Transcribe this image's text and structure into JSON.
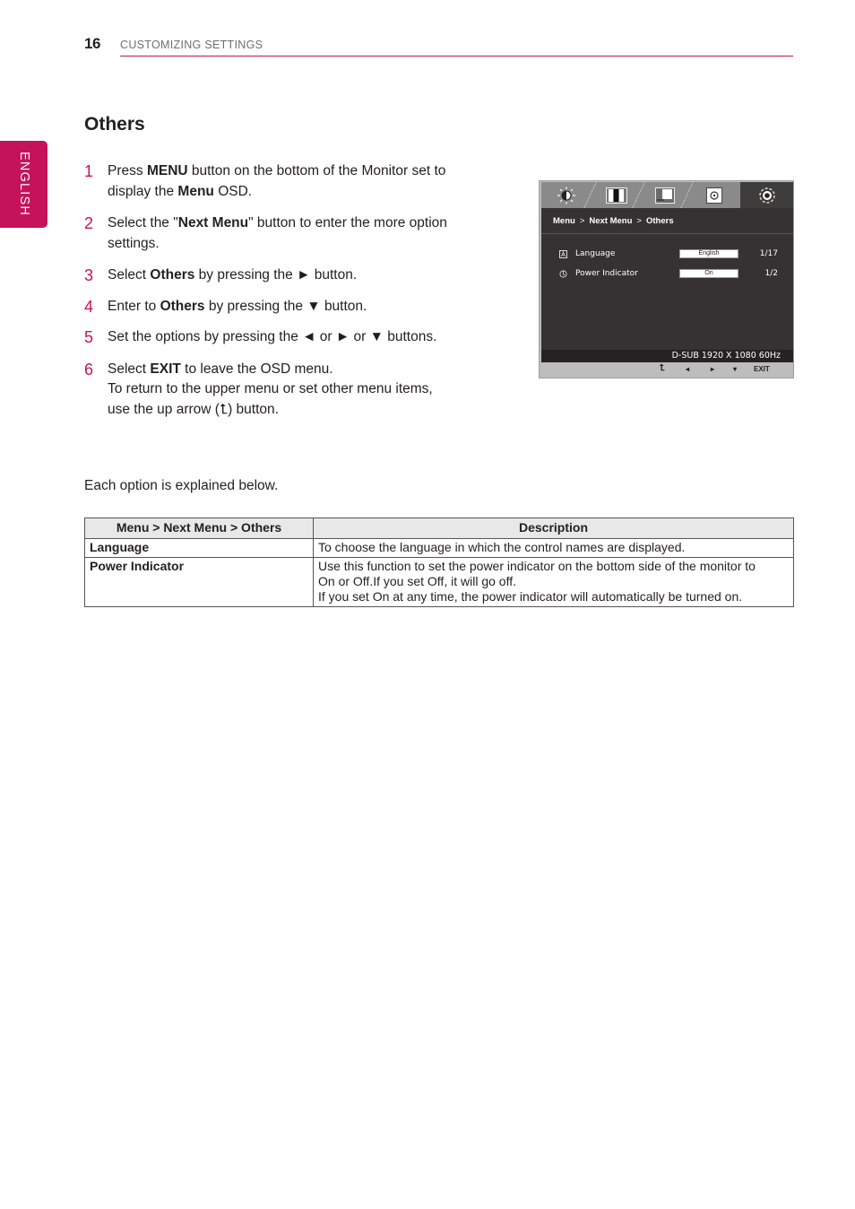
{
  "header": {
    "page_number": "16",
    "section": "CUSTOMIZING SETTINGS"
  },
  "language_tab": "ENGLISH",
  "title": "Others",
  "steps": [
    {
      "num": "1",
      "parts": [
        [
          "Press ",
          false
        ],
        [
          "MENU",
          true
        ],
        [
          " button on the bottom of the Monitor set to display the ",
          false
        ],
        [
          "Menu",
          true
        ],
        [
          " OSD.",
          false
        ]
      ]
    },
    {
      "num": "2",
      "parts": [
        [
          "Select the \"",
          false
        ],
        [
          "Next Menu",
          true
        ],
        [
          "\" button to enter the more option settings.",
          false
        ]
      ]
    },
    {
      "num": "3",
      "parts": [
        [
          "Select ",
          false
        ],
        [
          "Others",
          true
        ],
        [
          " by pressing the ► button.",
          false
        ]
      ]
    },
    {
      "num": "4",
      "parts": [
        [
          "Enter to ",
          false
        ],
        [
          "Others",
          true
        ],
        [
          " by pressing the ▼ button.",
          false
        ]
      ]
    },
    {
      "num": "5",
      "parts": [
        [
          "Set the options by pressing the ◄ or ► or ▼ buttons.",
          false
        ]
      ]
    },
    {
      "num": "6",
      "parts": [
        [
          "Select ",
          false
        ],
        [
          "EXIT",
          true
        ],
        [
          " to leave the OSD menu.",
          false
        ]
      ],
      "extra": [
        "To return to the upper menu or set other menu items,",
        "use the up arrow (⮤) button."
      ]
    }
  ],
  "osd": {
    "tabs": [
      {
        "icon": "brightness-icon",
        "glyph": "☀"
      },
      {
        "icon": "color-bars-icon",
        "glyph": "▥"
      },
      {
        "icon": "picture-icon",
        "glyph": "◧"
      },
      {
        "icon": "disc-icon",
        "glyph": "⊙"
      },
      {
        "icon": "gear-icon",
        "glyph": "⚙"
      }
    ],
    "breadcrumb": [
      "Menu",
      "Next Menu",
      "Others"
    ],
    "breadcrumb_sep": ">",
    "rows": [
      {
        "icon": "language-icon",
        "glyph": "A",
        "label": "Language",
        "value": "English",
        "count": "1/17"
      },
      {
        "icon": "power-icon",
        "glyph": "⏻",
        "label": "Power Indicator",
        "value": "On",
        "count": "1/2"
      }
    ],
    "status": "D-SUB 1920 X 1080 60Hz",
    "buttons": [
      {
        "name": "up-arrow",
        "glyph": "⮤"
      },
      {
        "name": "left",
        "glyph": "◂"
      },
      {
        "name": "right",
        "glyph": "▸"
      },
      {
        "name": "down",
        "glyph": "▾"
      },
      {
        "name": "exit",
        "glyph": "EXIT"
      }
    ]
  },
  "explain": "Each option is explained below.",
  "table": {
    "headers": [
      "Menu > Next Menu > Others",
      "Description"
    ],
    "rows": [
      {
        "name": "Language",
        "desc": [
          "To choose the language in which the control names are displayed."
        ]
      },
      {
        "name": "Power Indicator",
        "desc": [
          "Use this function to set the power indicator on the bottom side of the monitor to",
          "On or Off.If you set Off, it will go off.",
          "If you set On at any time, the power indicator will automatically be turned on."
        ]
      }
    ]
  },
  "colors": {
    "accent": "#c4135a",
    "rule": "#b5174f",
    "osd_bg": "#363233"
  }
}
